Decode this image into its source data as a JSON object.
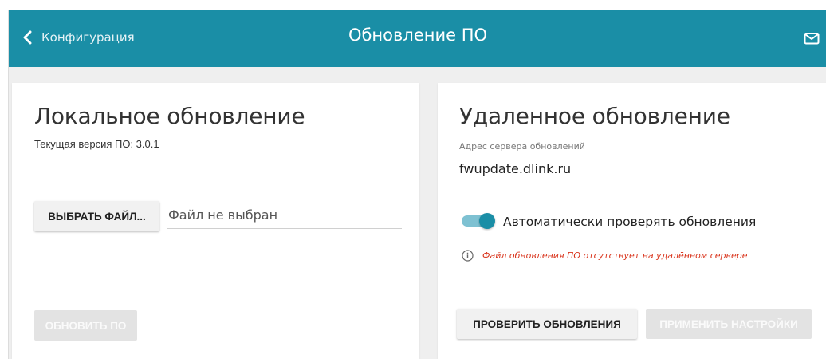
{
  "header": {
    "back_label": "Конфигурация",
    "title": "Обновление ПО",
    "accent_color": "#1a8ea6"
  },
  "icons": {
    "back": "chevron-left-icon",
    "mail": "mail-icon",
    "info": "info-icon"
  },
  "local": {
    "title": "Локальное обновление",
    "current_version": "Текущая версия ПО: 3.0.1",
    "choose_file_button": "ВЫБРАТЬ ФАЙЛ...",
    "file_status": "Файл не выбран",
    "update_button": "ОБНОВИТЬ ПО"
  },
  "remote": {
    "title": "Удаленное обновление",
    "server_label": "Адрес сервера обновлений",
    "server_value": "fwupdate.dlink.ru",
    "auto_check_label": "Автоматически проверять обновления",
    "auto_check_enabled": true,
    "info_message": "Файл обновления ПО отсутствует на удалённом сервере",
    "info_color": "#d9341c",
    "check_button": "ПРОВЕРИТЬ ОБНОВЛЕНИЯ",
    "apply_button": "ПРИМЕНИТЬ НАСТРОЙКИ"
  }
}
